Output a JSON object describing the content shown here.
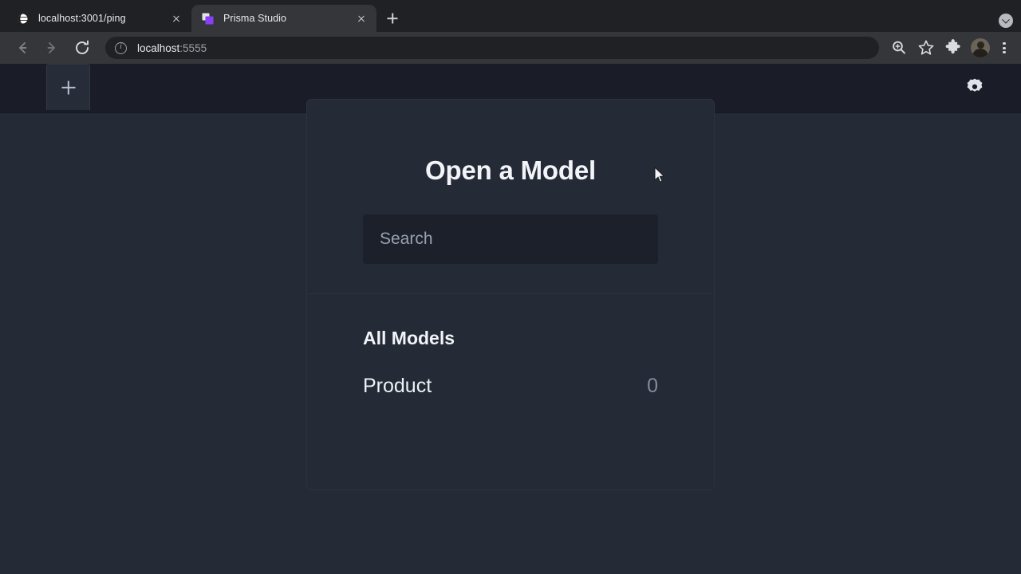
{
  "browser": {
    "tabs": [
      {
        "title": "localhost:3001/ping",
        "favicon": "globe-icon",
        "active": false
      },
      {
        "title": "Prisma Studio",
        "favicon": "prisma-squares-icon",
        "active": true
      }
    ],
    "new_tab_label": "+",
    "downloads_icon": "chevron-down-circle-icon",
    "toolbar": {
      "back_icon": "arrow-left-icon",
      "forward_icon": "arrow-right-icon",
      "reload_icon": "reload-icon",
      "site_info_icon": "info-circle-icon",
      "url_host": "localhost",
      "url_port": ":5555",
      "url_full": "localhost:5555",
      "search_icon": "zoom-search-icon",
      "bookmark_icon": "star-icon",
      "extensions_icon": "puzzle-piece-icon",
      "avatar_icon": "profile-avatar",
      "menu_icon": "three-dot-menu-icon"
    }
  },
  "app": {
    "header": {
      "add_tab_label": "+",
      "settings_icon": "gear-icon"
    },
    "card": {
      "title": "Open a Model",
      "search_placeholder": "Search",
      "search_value": "",
      "section_heading": "All Models",
      "models": [
        {
          "name": "Product",
          "count": "0"
        }
      ]
    }
  },
  "colors": {
    "browser_chrome": "#202124",
    "browser_toolbar": "#35363a",
    "app_header": "#1a1d28",
    "app_background": "#242a36",
    "card_border": "#2c3340",
    "input_background": "#1b202b",
    "accent_purple": "#8a3ff5",
    "text_primary": "#f2f4f8",
    "text_muted": "#828b9b"
  }
}
